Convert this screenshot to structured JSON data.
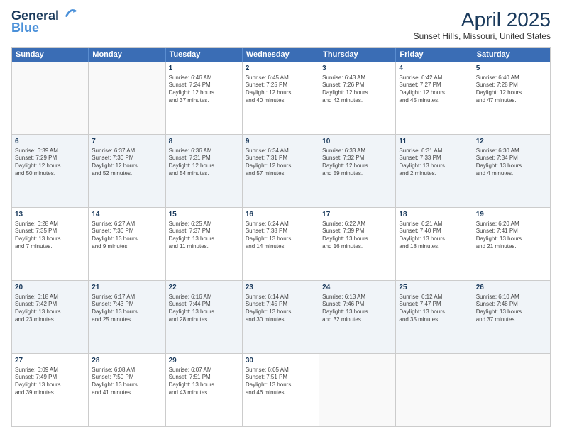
{
  "header": {
    "logo_line1": "General",
    "logo_line2": "Blue",
    "month_year": "April 2025",
    "location": "Sunset Hills, Missouri, United States"
  },
  "days_of_week": [
    "Sunday",
    "Monday",
    "Tuesday",
    "Wednesday",
    "Thursday",
    "Friday",
    "Saturday"
  ],
  "weeks": [
    [
      {
        "day": "",
        "info": ""
      },
      {
        "day": "",
        "info": ""
      },
      {
        "day": "1",
        "info": "Sunrise: 6:46 AM\nSunset: 7:24 PM\nDaylight: 12 hours\nand 37 minutes."
      },
      {
        "day": "2",
        "info": "Sunrise: 6:45 AM\nSunset: 7:25 PM\nDaylight: 12 hours\nand 40 minutes."
      },
      {
        "day": "3",
        "info": "Sunrise: 6:43 AM\nSunset: 7:26 PM\nDaylight: 12 hours\nand 42 minutes."
      },
      {
        "day": "4",
        "info": "Sunrise: 6:42 AM\nSunset: 7:27 PM\nDaylight: 12 hours\nand 45 minutes."
      },
      {
        "day": "5",
        "info": "Sunrise: 6:40 AM\nSunset: 7:28 PM\nDaylight: 12 hours\nand 47 minutes."
      }
    ],
    [
      {
        "day": "6",
        "info": "Sunrise: 6:39 AM\nSunset: 7:29 PM\nDaylight: 12 hours\nand 50 minutes."
      },
      {
        "day": "7",
        "info": "Sunrise: 6:37 AM\nSunset: 7:30 PM\nDaylight: 12 hours\nand 52 minutes."
      },
      {
        "day": "8",
        "info": "Sunrise: 6:36 AM\nSunset: 7:31 PM\nDaylight: 12 hours\nand 54 minutes."
      },
      {
        "day": "9",
        "info": "Sunrise: 6:34 AM\nSunset: 7:31 PM\nDaylight: 12 hours\nand 57 minutes."
      },
      {
        "day": "10",
        "info": "Sunrise: 6:33 AM\nSunset: 7:32 PM\nDaylight: 12 hours\nand 59 minutes."
      },
      {
        "day": "11",
        "info": "Sunrise: 6:31 AM\nSunset: 7:33 PM\nDaylight: 13 hours\nand 2 minutes."
      },
      {
        "day": "12",
        "info": "Sunrise: 6:30 AM\nSunset: 7:34 PM\nDaylight: 13 hours\nand 4 minutes."
      }
    ],
    [
      {
        "day": "13",
        "info": "Sunrise: 6:28 AM\nSunset: 7:35 PM\nDaylight: 13 hours\nand 7 minutes."
      },
      {
        "day": "14",
        "info": "Sunrise: 6:27 AM\nSunset: 7:36 PM\nDaylight: 13 hours\nand 9 minutes."
      },
      {
        "day": "15",
        "info": "Sunrise: 6:25 AM\nSunset: 7:37 PM\nDaylight: 13 hours\nand 11 minutes."
      },
      {
        "day": "16",
        "info": "Sunrise: 6:24 AM\nSunset: 7:38 PM\nDaylight: 13 hours\nand 14 minutes."
      },
      {
        "day": "17",
        "info": "Sunrise: 6:22 AM\nSunset: 7:39 PM\nDaylight: 13 hours\nand 16 minutes."
      },
      {
        "day": "18",
        "info": "Sunrise: 6:21 AM\nSunset: 7:40 PM\nDaylight: 13 hours\nand 18 minutes."
      },
      {
        "day": "19",
        "info": "Sunrise: 6:20 AM\nSunset: 7:41 PM\nDaylight: 13 hours\nand 21 minutes."
      }
    ],
    [
      {
        "day": "20",
        "info": "Sunrise: 6:18 AM\nSunset: 7:42 PM\nDaylight: 13 hours\nand 23 minutes."
      },
      {
        "day": "21",
        "info": "Sunrise: 6:17 AM\nSunset: 7:43 PM\nDaylight: 13 hours\nand 25 minutes."
      },
      {
        "day": "22",
        "info": "Sunrise: 6:16 AM\nSunset: 7:44 PM\nDaylight: 13 hours\nand 28 minutes."
      },
      {
        "day": "23",
        "info": "Sunrise: 6:14 AM\nSunset: 7:45 PM\nDaylight: 13 hours\nand 30 minutes."
      },
      {
        "day": "24",
        "info": "Sunrise: 6:13 AM\nSunset: 7:46 PM\nDaylight: 13 hours\nand 32 minutes."
      },
      {
        "day": "25",
        "info": "Sunrise: 6:12 AM\nSunset: 7:47 PM\nDaylight: 13 hours\nand 35 minutes."
      },
      {
        "day": "26",
        "info": "Sunrise: 6:10 AM\nSunset: 7:48 PM\nDaylight: 13 hours\nand 37 minutes."
      }
    ],
    [
      {
        "day": "27",
        "info": "Sunrise: 6:09 AM\nSunset: 7:49 PM\nDaylight: 13 hours\nand 39 minutes."
      },
      {
        "day": "28",
        "info": "Sunrise: 6:08 AM\nSunset: 7:50 PM\nDaylight: 13 hours\nand 41 minutes."
      },
      {
        "day": "29",
        "info": "Sunrise: 6:07 AM\nSunset: 7:51 PM\nDaylight: 13 hours\nand 43 minutes."
      },
      {
        "day": "30",
        "info": "Sunrise: 6:05 AM\nSunset: 7:51 PM\nDaylight: 13 hours\nand 46 minutes."
      },
      {
        "day": "",
        "info": ""
      },
      {
        "day": "",
        "info": ""
      },
      {
        "day": "",
        "info": ""
      }
    ]
  ]
}
